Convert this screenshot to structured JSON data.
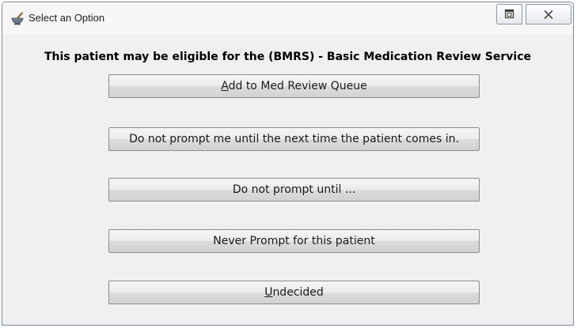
{
  "window": {
    "title": "Select an Option",
    "icon": "mortar-pestle-icon"
  },
  "titlebar_buttons": {
    "restore_icon": "restore-icon",
    "close_icon": "close-icon"
  },
  "dialog": {
    "heading": "This patient may be eligible for the (BMRS) - Basic Medication Review Service",
    "options": [
      {
        "access_key": "A",
        "rest": "dd to Med Review Queue"
      },
      {
        "label": "Do not prompt me until the next time the patient comes in."
      },
      {
        "label": "Do not prompt until ..."
      },
      {
        "label": "Never Prompt for this patient"
      },
      {
        "access_key": "U",
        "rest": "ndecided"
      }
    ]
  }
}
